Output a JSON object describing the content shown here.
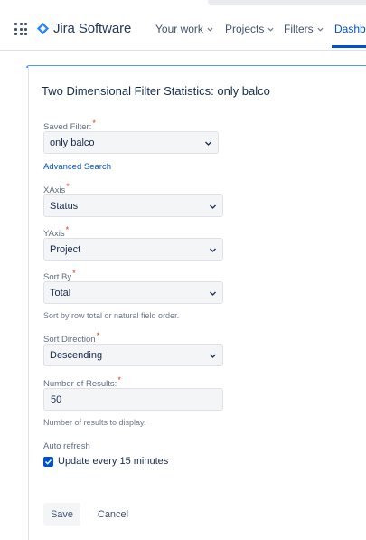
{
  "nav": {
    "brand": "Jira Software",
    "items": [
      {
        "label": "Your work"
      },
      {
        "label": "Projects"
      },
      {
        "label": "Filters"
      }
    ],
    "active": "Dashb"
  },
  "panel": {
    "title": "Two Dimensional Filter Statistics: only balco",
    "saved_filter": {
      "label": "Saved Filter:",
      "value": "only balco"
    },
    "advanced_search": "Advanced Search",
    "xaxis": {
      "label": "XAxis",
      "value": "Status"
    },
    "yaxis": {
      "label": "YAxis",
      "value": "Project"
    },
    "sort_by": {
      "label": "Sort By",
      "value": "Total",
      "help": "Sort by row total or natural field order."
    },
    "sort_direction": {
      "label": "Sort Direction",
      "value": "Descending"
    },
    "num_results": {
      "label": "Number of Results:",
      "value": "50",
      "help": "Number of results to display."
    },
    "auto_refresh": {
      "label": "Auto refresh",
      "checkbox_label": "Update every 15 minutes",
      "checked": true
    },
    "save_label": "Save",
    "cancel_label": "Cancel"
  },
  "icons": {
    "apps": "apps-grid-icon",
    "brand": "jira-logo-icon",
    "chevron": "chevron-down-icon",
    "check": "checkmark-icon"
  },
  "colors": {
    "accent": "#0052cc",
    "required": "#de350b",
    "panel_top": "#4c9aff"
  }
}
